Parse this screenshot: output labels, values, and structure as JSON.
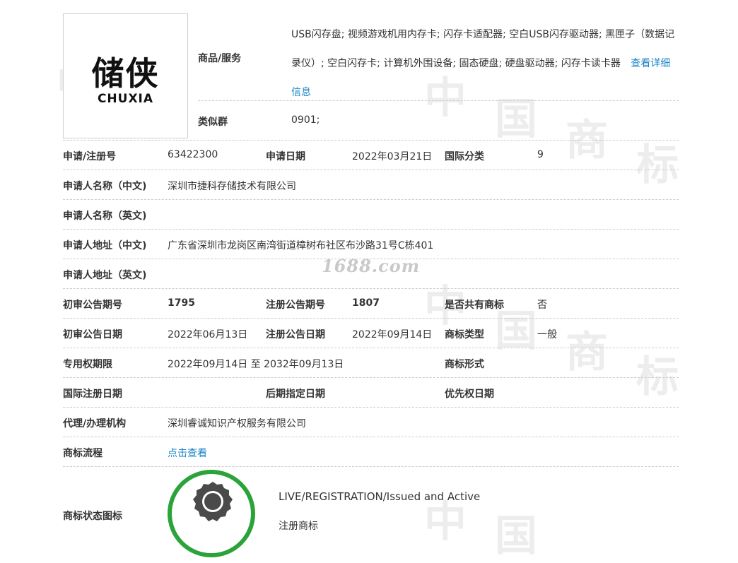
{
  "watermark": {
    "site": "1688.com",
    "tiles": [
      "中",
      "国",
      "商",
      "标"
    ]
  },
  "logo": {
    "zh": "储侠",
    "en": "CHUXIA"
  },
  "goods": {
    "label": "商品/服务",
    "text": "USB闪存盘; 视频游戏机用内存卡; 闪存卡适配器; 空白USB闪存驱动器; 黑匣子（数据记录仪）; 空白闪存卡; 计算机外围设备; 固态硬盘; 硬盘驱动器; 闪存卡读卡器",
    "more_link": "查看详细信息"
  },
  "similar": {
    "label": "类似群",
    "value": "0901;"
  },
  "rows": {
    "reg_no_label": "申请/注册号",
    "reg_no": "63422300",
    "apply_date_label": "申请日期",
    "apply_date": "2022年03月21日",
    "intl_class_label": "国际分类",
    "intl_class": "9",
    "applicant_cn_label": "申请人名称（中文)",
    "applicant_cn": "深圳市捷科存储技术有限公司",
    "applicant_en_label": "申请人名称（英文)",
    "applicant_en": "",
    "address_cn_label": "申请人地址（中文)",
    "address_cn": "广东省深圳市龙岗区南湾街道樟树布社区布沙路31号C栋401",
    "address_en_label": "申请人地址（英文)",
    "address_en": "",
    "prelim_no_label": "初审公告期号",
    "prelim_no": "1795",
    "reg_notice_no_label": "注册公告期号",
    "reg_notice_no": "1807",
    "shared_label": "是否共有商标",
    "shared": "否",
    "prelim_date_label": "初审公告日期",
    "prelim_date": "2022年06月13日",
    "reg_notice_date_label": "注册公告日期",
    "reg_notice_date": "2022年09月14日",
    "tm_type_label": "商标类型",
    "tm_type": "一般",
    "exclusive_label": "专用权期限",
    "exclusive": "2022年09月14日 至 2032年09月13日",
    "tm_form_label": "商标形式",
    "tm_form": "",
    "intl_reg_date_label": "国际注册日期",
    "intl_reg_date": "",
    "later_date_label": "后期指定日期",
    "later_date": "",
    "priority_label": "优先权日期",
    "priority": "",
    "agent_label": "代理/办理机构",
    "agent": "深圳睿诚知识产权服务有限公司",
    "process_label": "商标流程",
    "process_link": "点击查看",
    "status_label": "商标状态图标",
    "status_en": "LIVE/REGISTRATION/Issued and Active",
    "status_cn": "注册商标"
  },
  "colors": {
    "link": "#1a84c5",
    "badge_green": "#2aa339",
    "seal_gray": "#4a4a4a"
  }
}
